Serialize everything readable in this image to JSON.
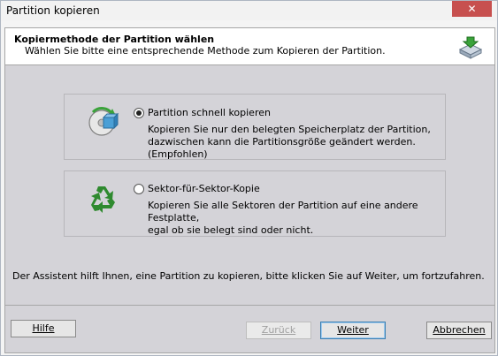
{
  "window": {
    "title": "Partition kopieren",
    "close_label": "✕"
  },
  "header": {
    "title": "Kopiermethode der Partition wählen",
    "subtitle": "Wählen Sie bitte eine entsprechende Methode zum Kopieren der Partition.",
    "icon": "disk-copy-icon"
  },
  "options": [
    {
      "label": "Partition schnell kopieren",
      "description_line1": "Kopieren Sie nur den belegten Speicherplatz der Partition,",
      "description_line2": "dazwischen kann die Partitionsgröße geändert werden.(Empfohlen)",
      "selected": true,
      "icon": "fast-copy-disc-icon"
    },
    {
      "label": "Sektor-für-Sektor-Kopie",
      "description_line1": "Kopieren Sie alle Sektoren der Partition auf eine andere Festplatte,",
      "description_line2": "egal ob sie belegt sind oder nicht.",
      "selected": false,
      "icon": "recycle-icon"
    }
  ],
  "footer_text": "Der Assistent hilft Ihnen, eine Partition zu kopieren, bitte klicken Sie auf Weiter, um fortzufahren.",
  "buttons": {
    "help": "Hilfe",
    "back": "Zurück",
    "next": "Weiter",
    "cancel": "Abbrechen"
  },
  "colors": {
    "close_button": "#c7504f",
    "client_background": "#d4d3d8",
    "recycle_green": "#2f8a2f"
  }
}
